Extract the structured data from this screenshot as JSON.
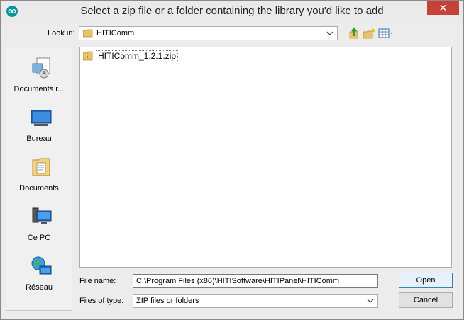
{
  "window": {
    "title": "Select a zip file or a folder containing the library you'd like to add",
    "close_symbol": "✕"
  },
  "lookin": {
    "label": "Look in:",
    "value": "HITIComm"
  },
  "toolbar": {
    "icons": [
      "up-folder-icon",
      "new-folder-icon",
      "view-menu-icon"
    ]
  },
  "sidebar": {
    "items": [
      {
        "label": "Documents r...",
        "icon": "recent-documents-icon"
      },
      {
        "label": "Bureau",
        "icon": "desktop-icon"
      },
      {
        "label": "Documents",
        "icon": "documents-folder-icon"
      },
      {
        "label": "Ce PC",
        "icon": "computer-icon"
      },
      {
        "label": "Réseau",
        "icon": "network-icon"
      }
    ]
  },
  "files": [
    {
      "name": "HITIComm_1.2.1.zip",
      "icon": "zip-folder-icon"
    }
  ],
  "filename": {
    "label": "File name:",
    "value": "C:\\Program Files (x86)\\HITISoftware\\HITIPanel\\HITIComm"
  },
  "filetype": {
    "label": "Files of type:",
    "value": "ZIP files or folders"
  },
  "buttons": {
    "open": "Open",
    "cancel": "Cancel"
  },
  "colors": {
    "close_button": "#c7403a",
    "app_icon": "#00979c"
  }
}
